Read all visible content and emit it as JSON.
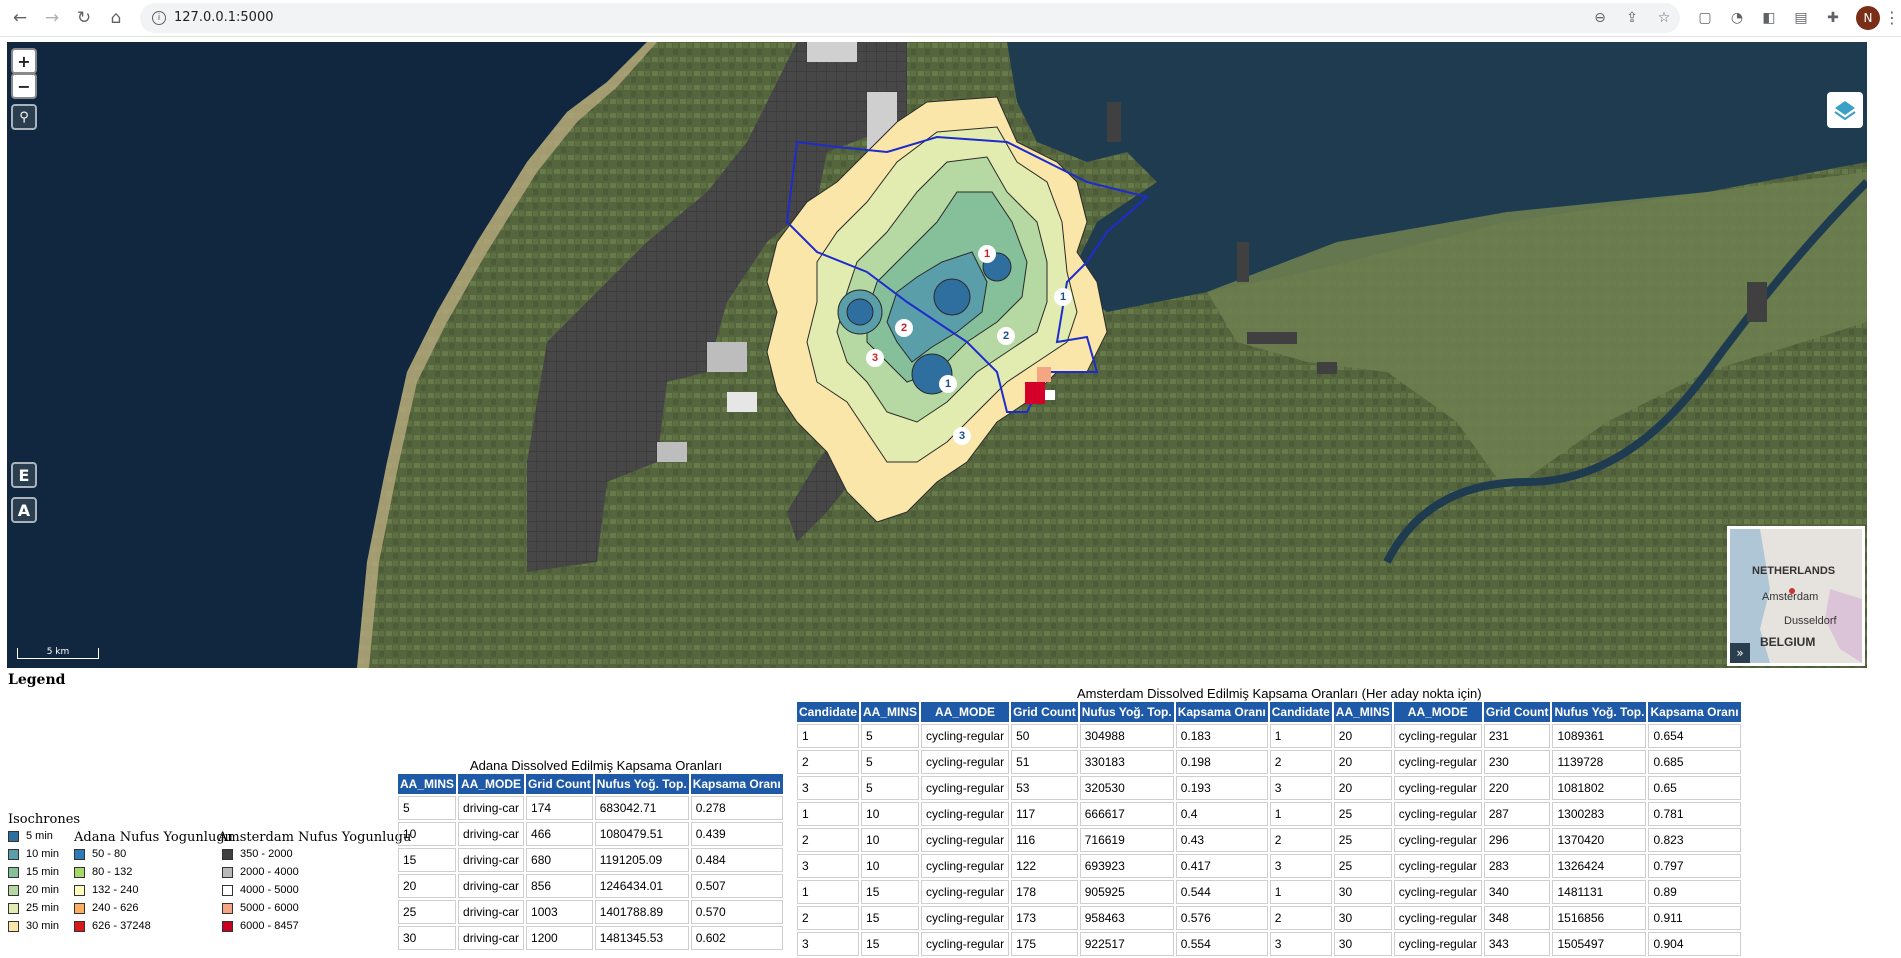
{
  "browser": {
    "url": "127.0.0.1:5000",
    "profile_initial": "N"
  },
  "map": {
    "zoom_in_label": "+",
    "zoom_out_label": "−",
    "btn_e_label": "E",
    "btn_a_label": "A",
    "scale_label": "5 km",
    "candidate_markers": [
      "1",
      "2",
      "3",
      "1",
      "2",
      "3",
      "1"
    ],
    "minimap": {
      "labels": [
        "NETHERLANDS",
        "Amsterdam",
        "Dusseldorf",
        "BELGIUM"
      ],
      "expand_label": "»"
    }
  },
  "legend": {
    "title": "Legend",
    "isochrones": {
      "title": "Isochrones",
      "items": [
        {
          "label": "5 min",
          "color": "#2f6f9f"
        },
        {
          "label": "10 min",
          "color": "#5a9eaa"
        },
        {
          "label": "15 min",
          "color": "#86c09b"
        },
        {
          "label": "20 min",
          "color": "#b6d9a3"
        },
        {
          "label": "25 min",
          "color": "#e3ecb0"
        },
        {
          "label": "30 min",
          "color": "#fae6a8"
        }
      ]
    },
    "adana": {
      "title": "Adana Nufus Yogunlugu",
      "items": [
        {
          "label": "50 - 80",
          "color": "#2c7bb6"
        },
        {
          "label": "80 - 132",
          "color": "#a6d96a"
        },
        {
          "label": "132 - 240",
          "color": "#ffffbf"
        },
        {
          "label": "240 - 626",
          "color": "#fdae61"
        },
        {
          "label": "626 - 37248",
          "color": "#d7191c"
        }
      ]
    },
    "amsterdam": {
      "title": "Amsterdam Nufus Yogunlugu",
      "items": [
        {
          "label": "350 - 2000",
          "color": "#404040"
        },
        {
          "label": "2000 - 4000",
          "color": "#bababa"
        },
        {
          "label": "4000 - 5000",
          "color": "#ffffff"
        },
        {
          "label": "5000 - 6000",
          "color": "#f4a582"
        },
        {
          "label": "6000 - 8457",
          "color": "#ca0020"
        }
      ]
    }
  },
  "adana_table": {
    "caption": "Adana Dissolved Edilmiş Kapsama Oranları",
    "headers": [
      "AA_MINS",
      "AA_MODE",
      "Grid Count",
      "Nufus Yoğ. Top.",
      "Kapsama Oranı"
    ],
    "rows": [
      [
        "5",
        "driving-car",
        "174",
        "683042.71",
        "0.278"
      ],
      [
        "10",
        "driving-car",
        "466",
        "1080479.51",
        "0.439"
      ],
      [
        "15",
        "driving-car",
        "680",
        "1191205.09",
        "0.484"
      ],
      [
        "20",
        "driving-car",
        "856",
        "1246434.01",
        "0.507"
      ],
      [
        "25",
        "driving-car",
        "1003",
        "1401788.89",
        "0.570"
      ],
      [
        "30",
        "driving-car",
        "1200",
        "1481345.53",
        "0.602"
      ]
    ]
  },
  "amsterdam_table": {
    "caption": "Amsterdam Dissolved Edilmiş Kapsama Oranları (Her aday nokta için)",
    "headers": [
      "Candidate",
      "AA_MINS",
      "AA_MODE",
      "Grid Count",
      "Nufus Yoğ. Top.",
      "Kapsama Oranı",
      "Candidate",
      "AA_MINS",
      "AA_MODE",
      "Grid Count",
      "Nufus Yoğ. Top.",
      "Kapsama Oranı"
    ],
    "rows": [
      [
        "1",
        "5",
        "cycling-regular",
        "50",
        "304988",
        "0.183",
        "1",
        "20",
        "cycling-regular",
        "231",
        "1089361",
        "0.654"
      ],
      [
        "2",
        "5",
        "cycling-regular",
        "51",
        "330183",
        "0.198",
        "2",
        "20",
        "cycling-regular",
        "230",
        "1139728",
        "0.685"
      ],
      [
        "3",
        "5",
        "cycling-regular",
        "53",
        "320530",
        "0.193",
        "3",
        "20",
        "cycling-regular",
        "220",
        "1081802",
        "0.65"
      ],
      [
        "1",
        "10",
        "cycling-regular",
        "117",
        "666617",
        "0.4",
        "1",
        "25",
        "cycling-regular",
        "287",
        "1300283",
        "0.781"
      ],
      [
        "2",
        "10",
        "cycling-regular",
        "116",
        "716619",
        "0.43",
        "2",
        "25",
        "cycling-regular",
        "296",
        "1370420",
        "0.823"
      ],
      [
        "3",
        "10",
        "cycling-regular",
        "122",
        "693923",
        "0.417",
        "3",
        "25",
        "cycling-regular",
        "283",
        "1326424",
        "0.797"
      ],
      [
        "1",
        "15",
        "cycling-regular",
        "178",
        "905925",
        "0.544",
        "1",
        "30",
        "cycling-regular",
        "340",
        "1481131",
        "0.89"
      ],
      [
        "2",
        "15",
        "cycling-regular",
        "173",
        "958463",
        "0.576",
        "2",
        "30",
        "cycling-regular",
        "348",
        "1516856",
        "0.911"
      ],
      [
        "3",
        "15",
        "cycling-regular",
        "175",
        "922517",
        "0.554",
        "3",
        "30",
        "cycling-regular",
        "343",
        "1505497",
        "0.904"
      ]
    ]
  }
}
